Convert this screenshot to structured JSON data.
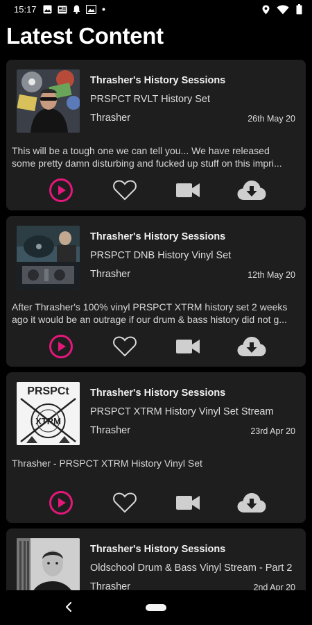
{
  "status": {
    "time": "15:17",
    "left_icons": [
      "image-icon",
      "news-icon",
      "bell-icon",
      "photo-icon",
      "dot-icon"
    ],
    "right_icons": [
      "location-icon",
      "wifi-icon",
      "battery-icon"
    ]
  },
  "page": {
    "title": "Latest Content"
  },
  "colors": {
    "accent": "#e5177b",
    "card": "#1e1e1e",
    "background": "#000000"
  },
  "items": [
    {
      "series": "Thrasher's History Sessions",
      "title": "PRSPCT RVLT History Set",
      "artist": "Thrasher",
      "date": "26th May 20",
      "description_lines": [
        "This will be a tough one we can tell you... We have released",
        "some pretty damn disturbing and fucked up stuff on this impri..."
      ]
    },
    {
      "series": "Thrasher's History Sessions",
      "title": "PRSPCT DNB History Vinyl Set",
      "artist": "Thrasher",
      "date": "12th May 20",
      "description_lines": [
        "After Thrasher's 100% vinyl PRSPCT XTRM history set 2 weeks",
        "ago it would be an outrage if our drum & bass history did not g..."
      ]
    },
    {
      "series": "Thrasher's History Sessions",
      "title": "PRSPCT XTRM History Vinyl Set Stream",
      "artist": "Thrasher",
      "date": "23rd Apr 20",
      "description_lines": [
        "Thrasher - PRSPCT XTRM History Vinyl Set"
      ],
      "thumb_text": {
        "logo": "PRSPCt",
        "sub": "XTRM"
      }
    },
    {
      "series": "Thrasher's History Sessions",
      "title": "Oldschool Drum & Bass Vinyl Stream  - Part 2",
      "artist": "Thrasher",
      "date": "2nd Apr 20"
    }
  ],
  "actions": [
    "play-icon",
    "heart-icon",
    "video-icon",
    "download-icon"
  ]
}
